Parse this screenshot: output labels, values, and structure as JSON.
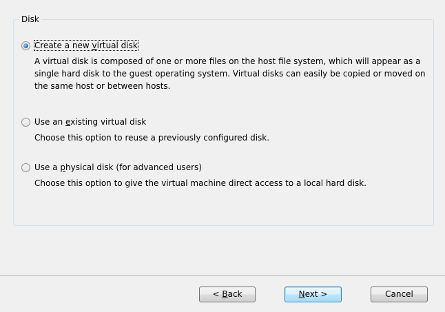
{
  "disk_group": {
    "title": "Disk",
    "options": [
      {
        "label_pre": "Create a new ",
        "label_accel": "v",
        "label_post": "irtual disk",
        "description": "A virtual disk is composed of one or more files on the host file system, which will appear as a single hard disk to the guest operating system. Virtual disks can easily be copied or moved on the same host or between hosts.",
        "selected": true
      },
      {
        "label_pre": "Use an ",
        "label_accel": "e",
        "label_post": "xisting virtual disk",
        "description": "Choose this option to reuse a previously configured disk.",
        "selected": false
      },
      {
        "label_pre": "Use a ",
        "label_accel": "p",
        "label_post": "hysical disk (for advanced users)",
        "description": "Choose this option to give the virtual machine direct access to a local hard disk.",
        "selected": false
      }
    ]
  },
  "buttons": {
    "back_pre": "< ",
    "back_accel": "B",
    "back_post": "ack",
    "next_accel": "N",
    "next_post": "ext >",
    "cancel": "Cancel"
  },
  "colors": {
    "background": "#f0f0f0",
    "group_border": "#d5dfe5",
    "radio_selected": "#2a6bb5",
    "default_button_border": "#3c7fb1"
  }
}
